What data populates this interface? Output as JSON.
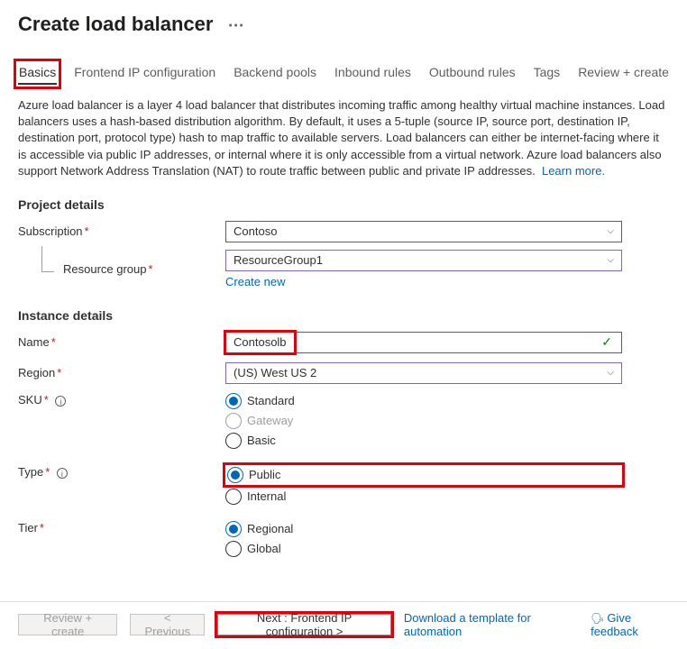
{
  "header": {
    "title": "Create load balancer"
  },
  "tabs": [
    {
      "label": "Basics",
      "active": true
    },
    {
      "label": "Frontend IP configuration",
      "active": false
    },
    {
      "label": "Backend pools",
      "active": false
    },
    {
      "label": "Inbound rules",
      "active": false
    },
    {
      "label": "Outbound rules",
      "active": false
    },
    {
      "label": "Tags",
      "active": false
    },
    {
      "label": "Review + create",
      "active": false
    }
  ],
  "description": {
    "text": "Azure load balancer is a layer 4 load balancer that distributes incoming traffic among healthy virtual machine instances. Load balancers uses a hash-based distribution algorithm. By default, it uses a 5-tuple (source IP, source port, destination IP, destination port, protocol type) hash to map traffic to available servers. Load balancers can either be internet-facing where it is accessible via public IP addresses, or internal where it is only accessible from a virtual network. Azure load balancers also support Network Address Translation (NAT) to route traffic between public and private IP addresses.",
    "learn_more": "Learn more."
  },
  "sections": {
    "project_details_title": "Project details",
    "instance_details_title": "Instance details"
  },
  "fields": {
    "subscription": {
      "label": "Subscription",
      "value": "Contoso"
    },
    "resource_group": {
      "label": "Resource group",
      "value": "ResourceGroup1",
      "create_new": "Create new"
    },
    "name": {
      "label": "Name",
      "value": "Contosolb"
    },
    "region": {
      "label": "Region",
      "value": "(US) West US 2"
    },
    "sku": {
      "label": "SKU",
      "options": [
        "Standard",
        "Gateway",
        "Basic"
      ],
      "selected": "Standard",
      "disabled": [
        "Gateway"
      ]
    },
    "type": {
      "label": "Type",
      "options": [
        "Public",
        "Internal"
      ],
      "selected": "Public"
    },
    "tier": {
      "label": "Tier",
      "options": [
        "Regional",
        "Global"
      ],
      "selected": "Regional"
    }
  },
  "footer": {
    "review_create": "Review + create",
    "previous": "< Previous",
    "next": "Next : Frontend IP configuration >",
    "download_template": "Download a template for automation",
    "give_feedback": "Give feedback"
  }
}
